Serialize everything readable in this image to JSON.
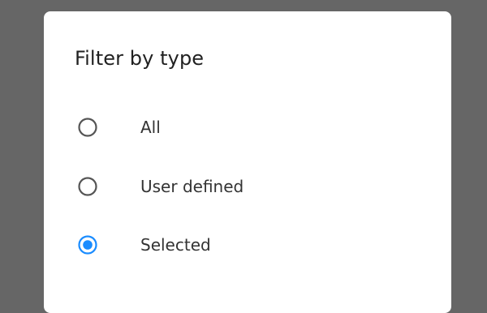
{
  "dialog": {
    "title": "Filter by type",
    "options": [
      {
        "label": "All",
        "selected": false
      },
      {
        "label": "User defined",
        "selected": false
      },
      {
        "label": "Selected",
        "selected": true
      }
    ]
  },
  "colors": {
    "scrim": "#666666",
    "dialog_background": "#ffffff",
    "title_text": "#212121",
    "option_text": "#333333",
    "radio_unselected": "#555555",
    "radio_selected": "#1a8cff"
  },
  "icons": {
    "unselected": "radio-unchecked-icon",
    "selected": "radio-checked-icon"
  }
}
